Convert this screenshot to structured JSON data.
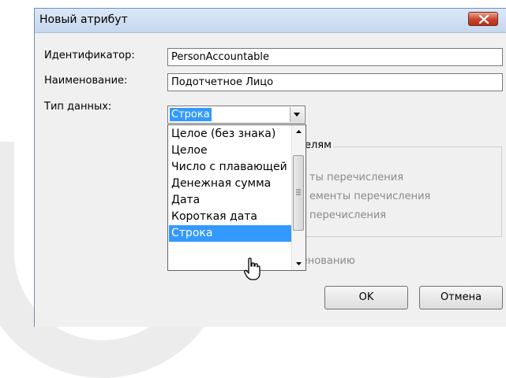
{
  "window": {
    "title": "Новый атрибут"
  },
  "form": {
    "identifier_label": "Идентификатор:",
    "identifier_value": "PersonAccountable",
    "name_label": "Наименование:",
    "name_value": "Подотчетное Лицо",
    "datatype_label": "Тип данных:",
    "datatype_value": "Строка"
  },
  "group": {
    "title_fragment": "елям",
    "line1": "ты перечисления",
    "line2": "ементы перечисления",
    "line3": "перечисления"
  },
  "sort_checkbox_label": "Сортировать по наименованию",
  "buttons": {
    "ok": "OK",
    "cancel": "Отмена"
  },
  "dropdown": {
    "items": [
      "Целое (без знака)",
      "Целое",
      "Число с плавающей",
      "Денежная сумма",
      "Дата",
      "Короткая дата",
      "Строка"
    ],
    "selected": "Строка"
  },
  "colors": {
    "selection": "#3399ff",
    "close_button": "#c7432a",
    "background": "#f0f0f0"
  }
}
